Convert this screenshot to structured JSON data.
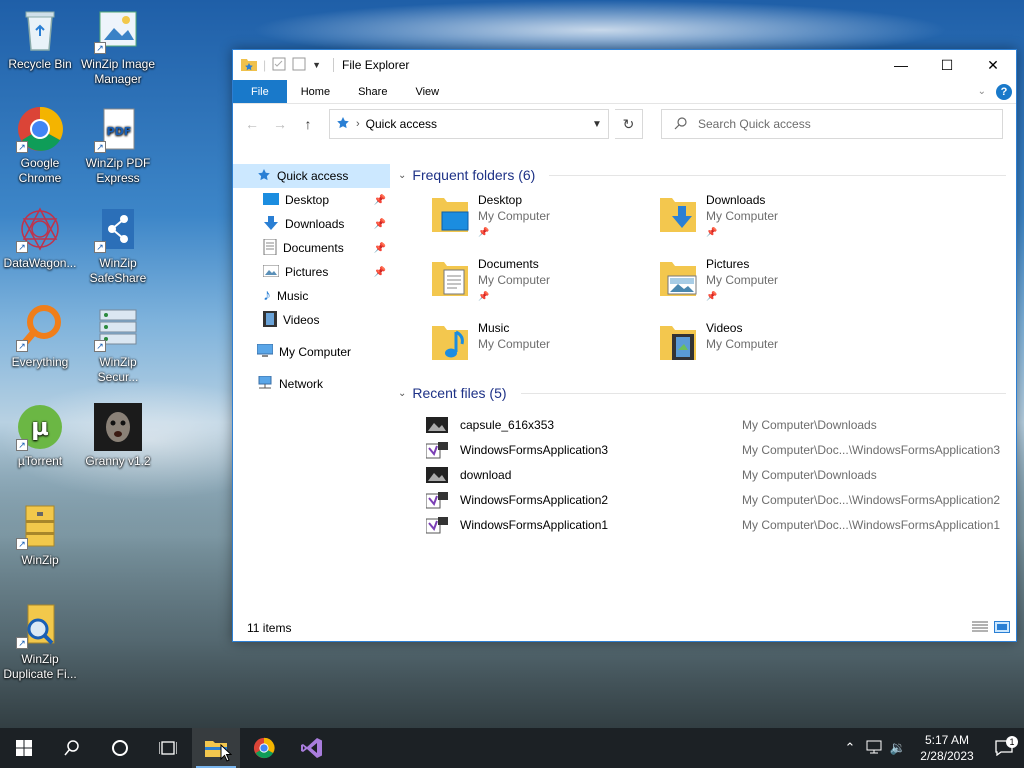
{
  "desktop": {
    "icons": [
      {
        "label": "Recycle Bin"
      },
      {
        "label": "WinZip Image Manager"
      },
      {
        "label": "Google Chrome"
      },
      {
        "label": "WinZip PDF Express"
      },
      {
        "label": "DataWagon..."
      },
      {
        "label": "WinZip SafeShare"
      },
      {
        "label": "Everything"
      },
      {
        "label": "WinZip Secur..."
      },
      {
        "label": "µTorrent"
      },
      {
        "label": "Granny v1.2"
      },
      {
        "label": "WinZip"
      },
      {
        "label": "WinZip Duplicate Fi..."
      }
    ]
  },
  "window": {
    "title": "File Explorer",
    "controls": {
      "minimize": "—",
      "maximize": "☐",
      "close": "✕"
    },
    "ribbon_tabs": [
      "File",
      "Home",
      "Share",
      "View"
    ],
    "help": "?",
    "address": {
      "location": "Quick access"
    },
    "search": {
      "placeholder": "Search Quick access"
    },
    "sidebar": {
      "quick_access": "Quick access",
      "items": [
        {
          "label": "Desktop"
        },
        {
          "label": "Downloads"
        },
        {
          "label": "Documents"
        },
        {
          "label": "Pictures"
        },
        {
          "label": "Music"
        },
        {
          "label": "Videos"
        }
      ],
      "my_computer": "My Computer",
      "network": "Network"
    },
    "frequent": {
      "heading": "Frequent folders (6)",
      "folders": [
        {
          "name": "Desktop",
          "location": "My Computer"
        },
        {
          "name": "Downloads",
          "location": "My Computer"
        },
        {
          "name": "Documents",
          "location": "My Computer"
        },
        {
          "name": "Pictures",
          "location": "My Computer"
        },
        {
          "name": "Music",
          "location": "My Computer"
        },
        {
          "name": "Videos",
          "location": "My Computer"
        }
      ]
    },
    "recent": {
      "heading": "Recent files (5)",
      "files": [
        {
          "name": "capsule_616x353",
          "path": "My Computer\\Downloads"
        },
        {
          "name": "WindowsFormsApplication3",
          "path": "My Computer\\Doc...\\WindowsFormsApplication3"
        },
        {
          "name": "download",
          "path": "My Computer\\Downloads"
        },
        {
          "name": "WindowsFormsApplication2",
          "path": "My Computer\\Doc...\\WindowsFormsApplication2"
        },
        {
          "name": "WindowsFormsApplication1",
          "path": "My Computer\\Doc...\\WindowsFormsApplication1"
        }
      ]
    },
    "status": {
      "items": "11 items"
    }
  },
  "taskbar": {
    "clock": {
      "time": "5:17 AM",
      "date": "2/28/2023"
    },
    "notification_count": "1"
  },
  "colors": {
    "accent": "#1979ca",
    "selection": "#cce8ff",
    "section_heading": "#1e3287"
  }
}
